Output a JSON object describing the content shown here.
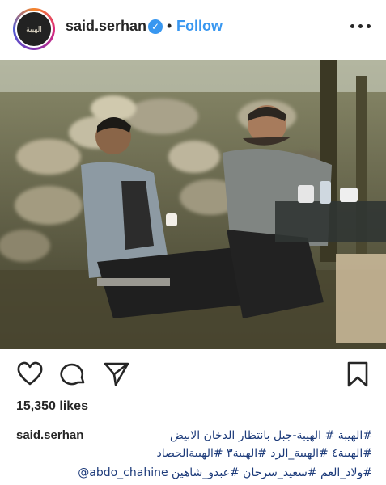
{
  "header": {
    "username": "said.serhan",
    "avatar_text": "الهيبة",
    "separator": "•",
    "follow_label": "Follow",
    "verified_icon": "verified-badge-icon",
    "more_icon": "more-options-icon"
  },
  "post": {
    "image_description_icon": "post-photo"
  },
  "actions": {
    "like_icon": "heart-icon",
    "comment_icon": "comment-icon",
    "share_icon": "share-icon",
    "save_icon": "bookmark-icon"
  },
  "likes": "15,350 likes",
  "caption": {
    "username": "said.serhan",
    "line1": "#الهيبة # الهيبة-جبل بانتظار الدخان الابيض",
    "line2": "#الهيبة٤ #الهيبة_الرد #الهيبة٣ #الهيبةالحصاد",
    "line3_mention": "@abdo_chahine",
    "line3_tags": "#ولاد_العم #سعيد_سرحان #عبدو_شاهين"
  },
  "colors": {
    "accent": "#3897f0",
    "text": "#262626",
    "hashtag": "#1d3b7a"
  }
}
